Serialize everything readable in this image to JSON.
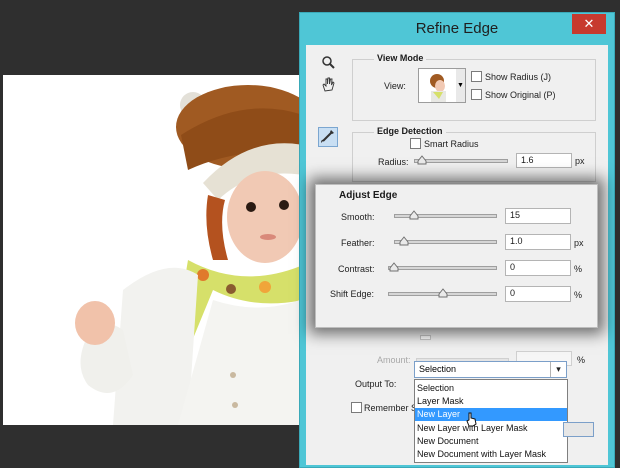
{
  "dialog": {
    "title": "Refine Edge",
    "close_glyph": "✕"
  },
  "tools": {
    "zoom_icon": "zoom-icon",
    "hand_icon": "hand-icon",
    "brush_icon": "refine-radius-brush-icon"
  },
  "view_mode": {
    "heading": "View Mode",
    "view_label": "View:",
    "show_radius": "Show Radius (J)",
    "show_original": "Show Original (P)"
  },
  "edge_detection": {
    "heading": "Edge Detection",
    "smart_radius": "Smart Radius",
    "radius_label": "Radius:",
    "radius_value": "1.6",
    "radius_unit": "px",
    "radius_level": 0.03
  },
  "adjust_edge": {
    "heading": "Adjust Edge",
    "rows": [
      {
        "label": "Smooth:",
        "value": "15",
        "unit": "",
        "level": 0.15
      },
      {
        "label": "Feather:",
        "value": "1.0",
        "unit": "px",
        "level": 0.04
      },
      {
        "label": "Contrast:",
        "value": "0",
        "unit": "%",
        "level": 0.0
      },
      {
        "label": "Shift Edge:",
        "value": "0",
        "unit": "%",
        "level": 0.5
      }
    ]
  },
  "output": {
    "amount_label": "Amount:",
    "amount_unit": "%",
    "output_to_label": "Output To:",
    "selected_value": "Selection",
    "remember_label": "Remember Se",
    "options": [
      "Selection",
      "Layer Mask",
      "New Layer",
      "New Layer with Layer Mask",
      "New Document",
      "New Document with Layer Mask"
    ],
    "highlighted_index": 2
  },
  "colors": {
    "window_border": "#4fc6d6",
    "close_button": "#c73a2e",
    "highlight": "#3399ff"
  }
}
